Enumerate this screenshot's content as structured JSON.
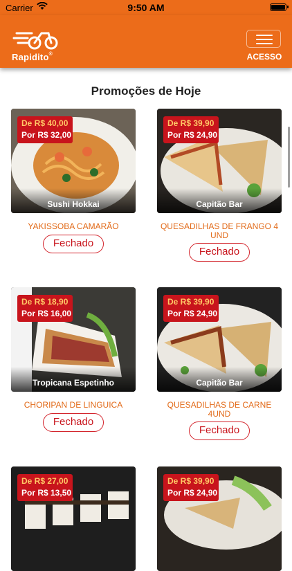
{
  "status_bar": {
    "carrier": "Carrier",
    "time": "9:50 AM"
  },
  "header": {
    "logo_text": "Rapidito",
    "logo_mark": "®",
    "menu_label": "ACESSO",
    "brand_color": "#ec6c1a"
  },
  "section_title": "Promoções de Hoje",
  "promotions": [
    {
      "store": "Sushi Hokkai",
      "old_price": "De R$ 40,00",
      "new_price": "Por R$ 32,00",
      "name": "YAKISSOBA CAMARÃO",
      "status": "Fechado"
    },
    {
      "store": "Capitão Bar",
      "old_price": "De R$ 39,90",
      "new_price": "Por R$ 24,90",
      "name": "QUESADILHAS DE FRANGO 4 UND",
      "status": "Fechado"
    },
    {
      "store": "Tropicana Espetinho",
      "old_price": "De R$ 18,90",
      "new_price": "Por R$ 16,00",
      "name": "CHORIPAN DE LINGUICA",
      "status": "Fechado"
    },
    {
      "store": "Capitão Bar",
      "old_price": "De R$ 39,90",
      "new_price": "Por R$ 24,90",
      "name": "QUESADILHAS DE CARNE 4UND",
      "status": "Fechado"
    },
    {
      "store": "",
      "old_price": "De R$ 27,00",
      "new_price": "Por R$ 13,50",
      "name": "",
      "status": ""
    },
    {
      "store": "",
      "old_price": "De R$ 39,90",
      "new_price": "Por R$ 24,90",
      "name": "",
      "status": ""
    }
  ],
  "colors": {
    "price_badge": "#c8141c",
    "old_price_text": "#ffc766",
    "item_name": "#e26a18",
    "status_border": "#d3232b"
  }
}
